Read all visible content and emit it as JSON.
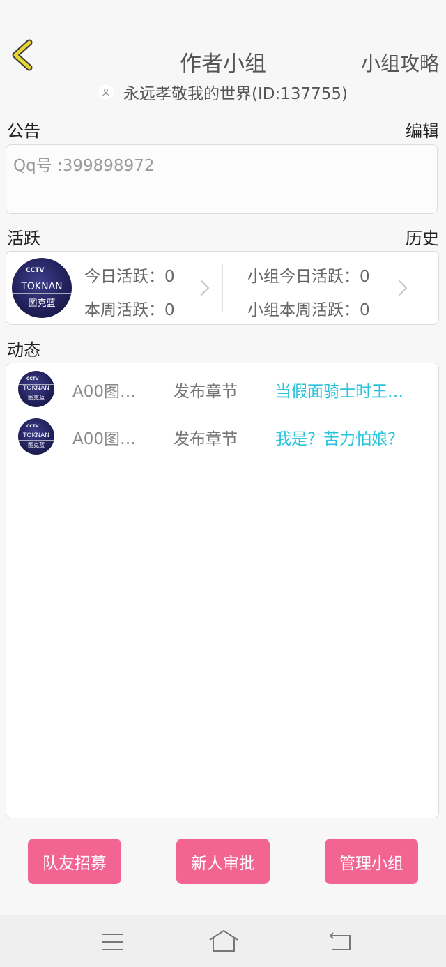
{
  "header": {
    "title": "作者小组",
    "guide_label": "小组攻略"
  },
  "owner": {
    "text": "永远孝敬我的世界(ID:137755)"
  },
  "notice": {
    "label": "公告",
    "edit_label": "编辑",
    "content": "Qq号 :399898972"
  },
  "activity": {
    "label": "活跃",
    "history_label": "历史",
    "today": "今日活跃：0",
    "week": "本周活跃：0",
    "group_today": "小组今日活跃：0",
    "group_week": "小组本周活跃：0"
  },
  "logo": {
    "cctv": "CCTV",
    "brand": "TOKNAN",
    "brand_cn": "图克蓝"
  },
  "feed": {
    "label": "动态",
    "items": [
      {
        "user": "A00图…",
        "action": "发布章节",
        "title": "当假面骑士时王…"
      },
      {
        "user": "A00图…",
        "action": "发布章节",
        "title": "我是？苦力怕娘？"
      }
    ]
  },
  "buttons": {
    "recruit": "队友招募",
    "approve": "新人审批",
    "manage": "管理小组"
  },
  "colors": {
    "accent_pink": "#f26592",
    "link_cyan": "#29c3dc",
    "back_arrow": "#e8d630"
  }
}
